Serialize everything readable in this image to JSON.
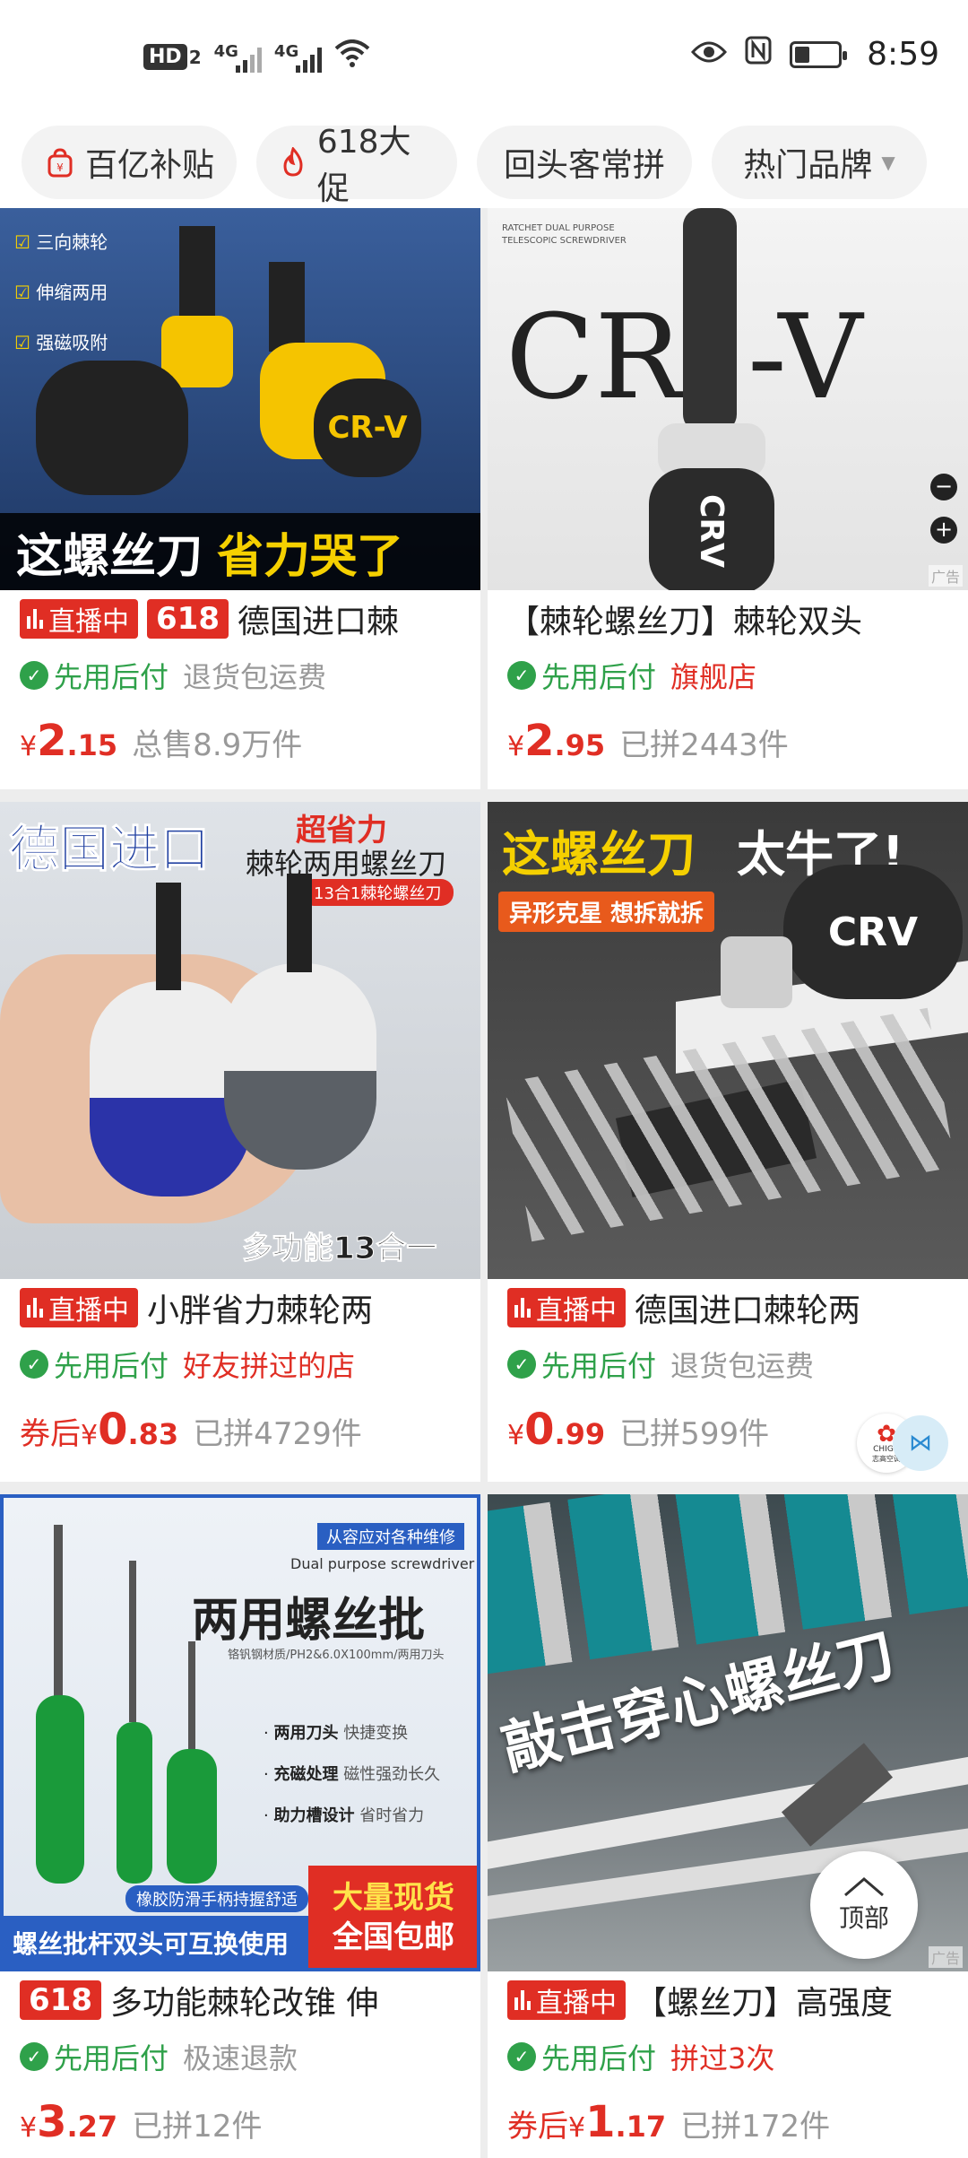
{
  "status_bar": {
    "hd": "HD",
    "sim": "2",
    "net1": "4G",
    "net2": "4G",
    "time": "8:59"
  },
  "filters": [
    {
      "label": "百亿补贴",
      "icon": "bag-icon"
    },
    {
      "label": "618大促",
      "icon": "flame-icon"
    },
    {
      "label": "回头客常拼",
      "icon": ""
    },
    {
      "label": "热门品牌",
      "icon": "caret-down-icon"
    }
  ],
  "products": [
    {
      "image_text": [
        "三向棘轮",
        "伸缩两用",
        "强磁吸附",
        "这螺丝刀",
        "省力哭了",
        "CR-V"
      ],
      "live_badge": "直播中",
      "promo_badge": "618",
      "title": "德国进口棘",
      "pay_label": "先用后付",
      "tag": "退货包运费",
      "tag_color": "gray",
      "price_prefix": "",
      "currency": "¥",
      "price_int": "2",
      "price_dec": ".15",
      "sales": "总售8.9万件"
    },
    {
      "image_text": [
        "RATCHET DUAL PURPOSE  TELESCOPIC SCREWDRIVER",
        "CR",
        "-V",
        "CRV",
        "广告"
      ],
      "title": "【棘轮螺丝刀】棘轮双头",
      "pay_label": "先用后付",
      "tag": "旗舰店",
      "tag_color": "red",
      "price_prefix": "",
      "currency": "¥",
      "price_int": "2",
      "price_dec": ".95",
      "sales": "已拼2443件"
    },
    {
      "image_text": [
        "德国进口",
        "超省力",
        "棘轮两用螺丝刀",
        "13合1棘轮螺丝刀",
        "多功能13合一"
      ],
      "live_badge": "直播中",
      "title": "小胖省力棘轮两",
      "pay_label": "先用后付",
      "tag": "好友拼过的店",
      "tag_color": "red",
      "price_prefix": "券后",
      "currency": "¥",
      "price_int": "0",
      "price_dec": ".83",
      "sales": "已拼4729件"
    },
    {
      "image_text": [
        "这螺丝刀",
        "太牛了!",
        "异形克星 想拆就拆",
        "CRV"
      ],
      "live_badge": "直播中",
      "title": "德国进口棘轮两",
      "pay_label": "先用后付",
      "tag": "退货包运费",
      "tag_color": "gray",
      "price_prefix": "",
      "currency": "¥",
      "price_int": "0",
      "price_dec": ".99",
      "sales": "已拼599件",
      "store_logo_text": [
        "CHIGO",
        "志高空调"
      ]
    },
    {
      "image_text": [
        "从容应对各种维修",
        "Dual purpose screwdriver",
        "两用螺丝批",
        "铬钒钢材质/PH2&6.0X100mm/两用刀头",
        "两用刀头",
        "快捷变换",
        "充磁处理",
        "磁性强劲长久",
        "助力槽设计",
        "省时省力",
        "橡胶防滑手柄持握舒适",
        "螺丝批杆双头可互换使用",
        "大量现货",
        "全国包邮"
      ],
      "promo_badge": "618",
      "title": "多功能棘轮改锥 伸",
      "pay_label": "先用后付",
      "tag": "极速退款",
      "tag_color": "gray",
      "price_prefix": "",
      "currency": "¥",
      "price_int": "3",
      "price_dec": ".27",
      "sales": "已拼12件"
    },
    {
      "image_text": [
        "敲击穿心螺丝刀",
        "广告"
      ],
      "live_badge": "直播中",
      "title": "【螺丝刀】高强度",
      "pay_label": "先用后付",
      "tag": "拼过3次",
      "tag_color": "red",
      "price_prefix": "券后",
      "currency": "¥",
      "price_int": "1",
      "price_dec": ".17",
      "sales": "已拼172件"
    }
  ],
  "back_to_top": "顶部",
  "colors": {
    "accent_red": "#e02e24",
    "pay_green": "#2fa14a",
    "gray_text": "#999999"
  }
}
